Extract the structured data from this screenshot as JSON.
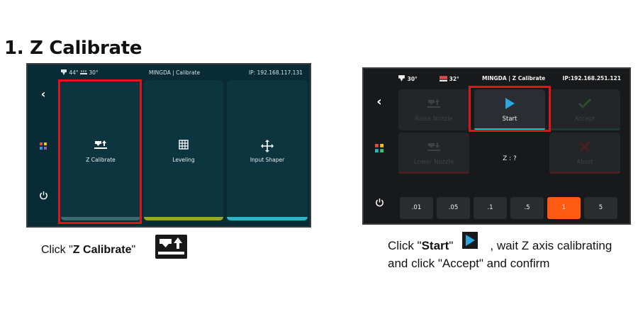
{
  "heading": "1.  Z Calibrate",
  "screen1": {
    "nozzle_temp": "44°",
    "bed_temp": "30°",
    "title": "MINGDA | Calibrate",
    "ip": "IP: 192.168.117.131",
    "cards": [
      {
        "label": "Z Calibrate",
        "bar_color": "#3a6b73"
      },
      {
        "label": "Leveling",
        "bar_color": "#9aa82a"
      },
      {
        "label": "Input Shaper",
        "bar_color": "#27b8c6"
      }
    ]
  },
  "screen2": {
    "nozzle_temp": "30°",
    "bed_temp": "32°",
    "title": "MINGDA  | Z Calibrate",
    "ip": "IP:192.168.251.121",
    "buttons": {
      "raise_nozzle": "Raise Nozzle",
      "start": "Start",
      "accept": "Accept",
      "lower_nozzle": "Lower Nozzle",
      "abort": "Abort"
    },
    "z_readout": "Z : ?",
    "steps": [
      ".01",
      ".05",
      ".1",
      ".5",
      "1",
      "5"
    ],
    "selected_step": "1",
    "accent": "#ff5a12"
  },
  "caption1": {
    "pre": "Click \"",
    "bold": "Z Calibrate",
    "post": "\""
  },
  "caption2": {
    "pre": "Click \"",
    "bold": "Start",
    "mid": "\"",
    "post": ", wait Z axis calibrating",
    "line2": "and click \"Accept\" and confirm"
  }
}
